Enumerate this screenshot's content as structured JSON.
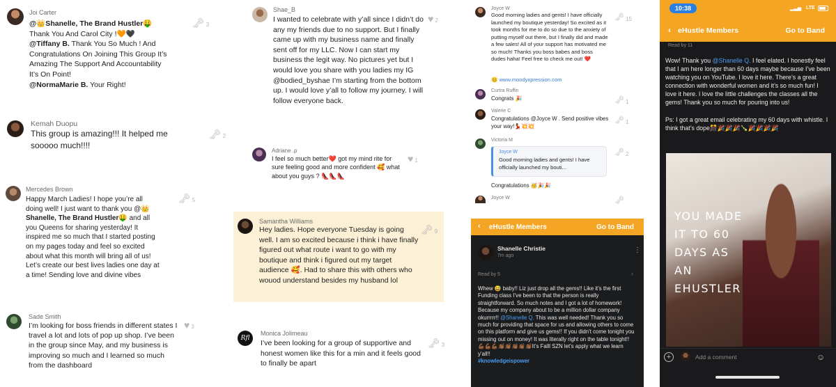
{
  "colors": {
    "accent_orange": "#f5a524",
    "link_blue": "#4a90e2",
    "highlight": "#fcf1d6",
    "dark_bg": "#1b1c1e"
  },
  "posts": {
    "joi": {
      "name": "Joi Carter",
      "mention1": "@👑Shanelle, The Brand Hustler🤑",
      "line2": "Thank You And Carol City !🧡🖤",
      "mention2": "@Tiffany B.",
      "line3": " Thank You So Much ! And",
      "line4": "Congratulations On Joining This Group It’s",
      "line5": "Amazing The Support And Accountability",
      "line6": "It’s On Point!",
      "mention3": "@NormaMarie B.",
      "line7": " Your Right!",
      "likes": "3"
    },
    "kemah": {
      "name": "Kemah Duopu",
      "text": "This group is amazing!!! It helped me sooooo much!!!!",
      "likes": "2"
    },
    "mercedes": {
      "name": "Mercedes Brown",
      "l1": "Happy March Ladies! I hope you’re all",
      "l2": "doing well! I just want to thank you @👑",
      "l3b": "Shanelle, The Brand Hustler🤑",
      "l3": " and all",
      "l4": "you Queens for sharing yesterday! It",
      "l5": "inspired me so much that I started posting",
      "l6": "on my pages today and feel so excited",
      "l7": "about what this month will bring all of us!",
      "l8": "Let’s create our best lives ladies one day at",
      "l9": "a time! Sending love and divine vibes",
      "likes": "5"
    },
    "sade": {
      "name": "Sade Smith",
      "text": "I’m looking for boss friends in different states I travel a lot and lots of pop up shop. I’ve been in the group since May, and my business is improving so much and I learned so much from the dashboard",
      "likes": "3"
    },
    "shae": {
      "name": "Shae_B",
      "text": "I wanted to celebrate with y’all since I didn’t do any my friends due to no support. But I finally came up with my business name and finally sent off for my LLC. Now I can start my business the legit way. No pictures yet but I would love you share with you ladies my IG @bodied_byshae I’m starting from the bottom up. I would love y’all to follow my journey. I will follow everyone back.",
      "likes": "2"
    },
    "adriane": {
      "name": "Adriane .p",
      "text": "I feel so much better❤️ got my mind rite for sure feeling good and more confident 🥰 what about you guys ? 👠👠👠",
      "likes": "1"
    },
    "samantha": {
      "name": "Samantha Williams",
      "text": "Hey ladies. Hope everyone Tuesday is going well. I am so excited because i think i have finally figured out what route i want to go with my boutique and think i figured out my target audience 🥰. Had to share this with others who wouod understand besides my husband lol",
      "likes": "9"
    },
    "monica": {
      "name": "Monica Jolimeau",
      "avatar_text": "Rfl",
      "text": "I’ve been looking for a group of supportive and honest women like this for a min and it feels good to finally be apart",
      "likes": "3"
    }
  },
  "feed_small": {
    "joyce1": {
      "name": "Joyce W",
      "text": "Good morning ladies and gents! I have officially launched my boutique yesterday! So excited as it took months for me to do so due to the anxiety of putting myself out there, but I finally did and made a few sales! All of your support has motivated me so much! Thanks you boss babes and boss dudes haha! Feel free to check me out! ❤️",
      "link": "😊 www.moodyxpression.com",
      "likes": "15"
    },
    "curtra": {
      "name": "Curtra Ruffin",
      "text": "Congrats 🎉",
      "likes": "1"
    },
    "valerie": {
      "name": "Valerie C",
      "text": "Congratulations @Joyce W . Send positive vibes your way!💃🏾💥💥",
      "likes": "1"
    },
    "victoria": {
      "name": "Victoria M",
      "quote_name": "Joyce W",
      "quote_text": "Good morning ladies and gents! I have officially launched my bouti...",
      "text": "Congratulations 🥳🎉🎉",
      "likes": "2"
    },
    "joyce2": {
      "name": "Joyce W"
    }
  },
  "dark1": {
    "header_title": "eHustle Members",
    "go_to_band": "Go to Band",
    "author": "Shanelle Christie",
    "time": "7m ago",
    "read_by": "Read by 5",
    "body1": "Whew 😅 baby!! Liz just drop all the gems!! Like it’s the first Funding class I’ve been to that the person is really straightforward. So much notes and I got a lot of homework! Because my company about to be a million dollar company okurrrrr!!",
    "mention": "@Shanelle Q.",
    "body2": " This was well needed! Thank you so much for providing that space for us and allowing others to come on this platform and give us gems!! If you didn’t come tonight you missing out on money! It was literally right on the table tonight!! 💪🏾💪🏾💪🏾👏🏾👏🏾👏🏾👏🏾👏🏾It’s Falll SZN let’s apply what we learn y’all!!",
    "hashtag": "#knowledgeispower"
  },
  "phone2": {
    "time": "10:38",
    "network": "LTE",
    "header_title": "eHustle Members",
    "go_to_band": "Go to Band",
    "read_by": "Read by 11",
    "p1a": "Wow! Thank you ",
    "mention": "@Shanelle Q.",
    "p1b": "  I feel elated. I honestly feel that I am here longer than 60 days maybe because I’ve been watching you on YouTube. I love it here. There’s a great connection with wonderful  women and it’s so much fun! I love it here. I love the little challenges the classes all the gems! Thank you so much for pouring into us!",
    "p2": "Ps: I got a great email celebrating my 60 days with whistle. I think that’s dope🎊🎉🎉🎉🍾🎉🎉🎉🎉",
    "image_caption": "YOU MADE IT TO 60 DAYS AS AN EHUSTLER",
    "comment_placeholder": "Add a comment"
  }
}
